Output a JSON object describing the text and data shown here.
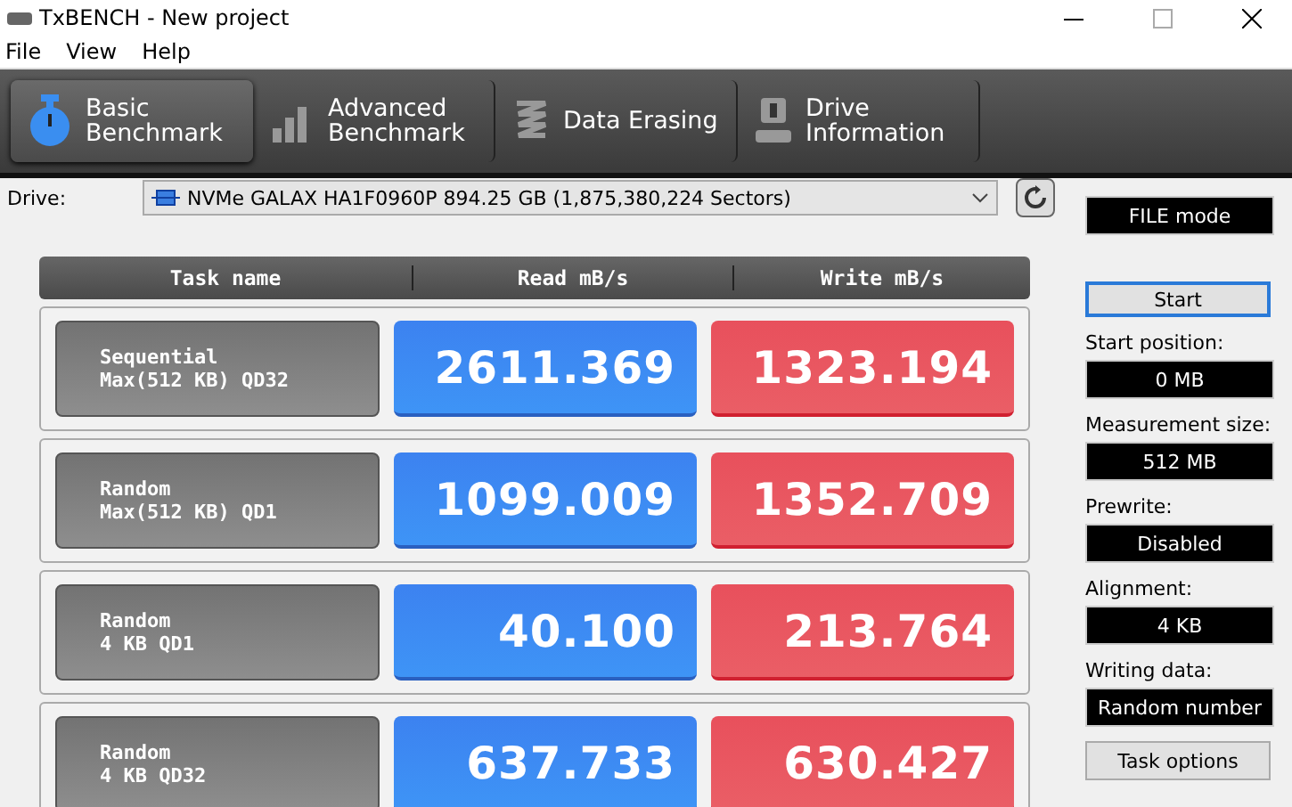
{
  "window": {
    "title": "TxBENCH - New project"
  },
  "menu": [
    "File",
    "View",
    "Help"
  ],
  "tabs": [
    {
      "label": "Basic\nBenchmark",
      "kind": "timer",
      "selected": true
    },
    {
      "label": "Advanced\nBenchmark",
      "kind": "bars",
      "selected": false
    },
    {
      "label": "Data Erasing",
      "kind": "spring",
      "selected": false
    },
    {
      "label": "Drive\nInformation",
      "kind": "drive",
      "selected": false
    }
  ],
  "drive": {
    "label": "Drive:",
    "value": "NVMe GALAX HA1F0960P  894.25 GB (1,875,380,224 Sectors)"
  },
  "table": {
    "columns": [
      "Task name",
      "Read mB/s",
      "Write mB/s"
    ],
    "rows": [
      {
        "task": "Sequential\nMax(512 KB) QD32",
        "read": "2611.369",
        "write": "1323.194"
      },
      {
        "task": "Random\nMax(512 KB) QD1",
        "read": "1099.009",
        "write": "1352.709"
      },
      {
        "task": "Random\n4 KB QD1",
        "read": "40.100",
        "write": "213.764"
      },
      {
        "task": "Random\n4 KB QD32",
        "read": "637.733",
        "write": "630.427"
      }
    ]
  },
  "side": {
    "mode": "FILE mode",
    "start": "Start",
    "settings": [
      {
        "label": "Start position:",
        "value": "0 MB"
      },
      {
        "label": "Measurement size:",
        "value": "512 MB"
      },
      {
        "label": "Prewrite:",
        "value": "Disabled"
      },
      {
        "label": "Alignment:",
        "value": "4 KB"
      },
      {
        "label": "Writing data:",
        "value": "Random number"
      }
    ],
    "task_options": "Task options"
  }
}
